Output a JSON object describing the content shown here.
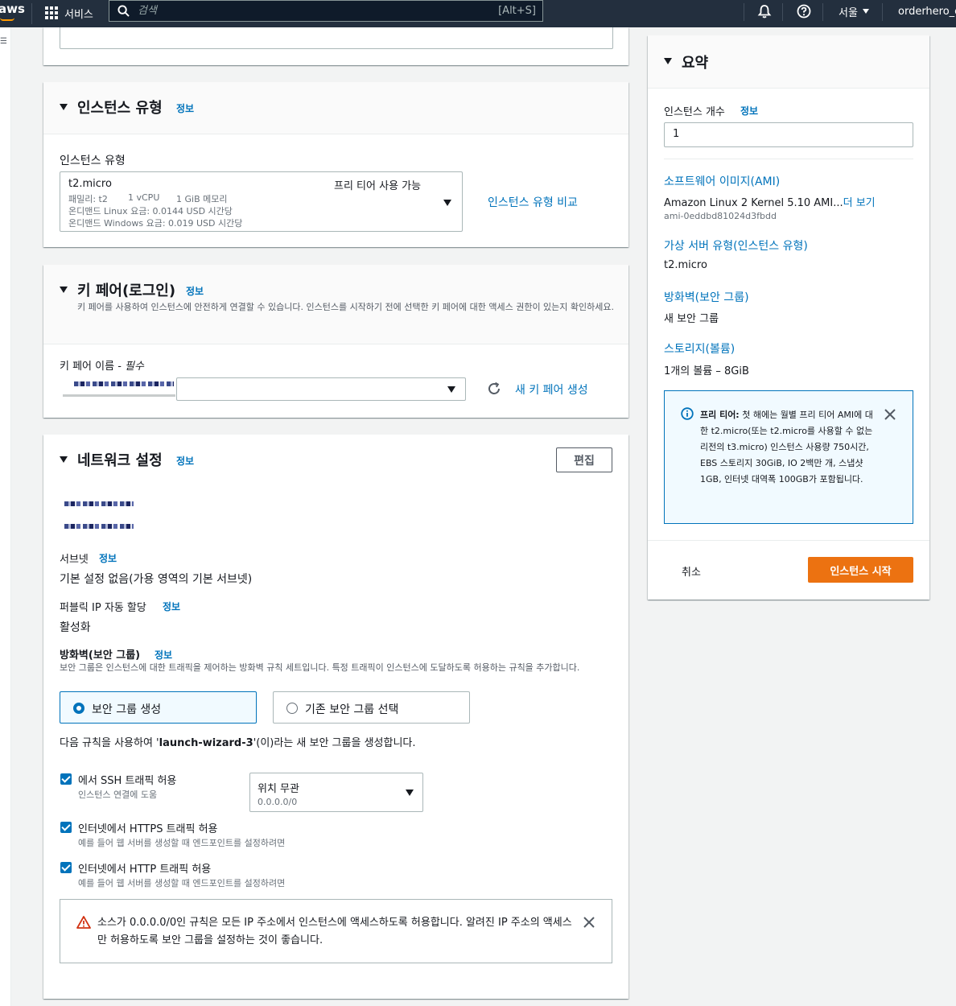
{
  "nav": {
    "logo": "aws",
    "services_label": "서비스",
    "search_placeholder": "검색",
    "search_shortcut": "[Alt+S]",
    "region": "서울",
    "account": "orderhero_ch"
  },
  "left_rail": {
    "glyph": "☰"
  },
  "instance_type": {
    "title": "인스턴스 유형",
    "info": "정보",
    "field_label": "인스턴스 유형",
    "selected": {
      "name": "t2.micro",
      "free_tier": "프리 티어 사용 가능",
      "family": "패밀리: t2",
      "vcpu": "1 vCPU",
      "memory": "1 GiB 메모리",
      "linux_price": "온디맨드 Linux 요금: 0.0144 USD 시간당",
      "windows_price": "온디맨드 Windows 요금: 0.019 USD 시간당"
    },
    "compare_link": "인스턴스 유형 비교"
  },
  "key_pair": {
    "title": "키 페어(로그인)",
    "info": "정보",
    "description": "키 페어를 사용하여 인스턴스에 안전하게 연결할 수 있습니다. 인스턴스를 시작하기 전에 선택한 키 페어에 대한 액세스 권한이 있는지 확인하세요.",
    "field_label": "키 페어 이름 - ",
    "required": "필수",
    "create_link": "새 키 페어 생성"
  },
  "network": {
    "title": "네트워크 설정",
    "info": "정보",
    "edit_button": "편집",
    "subnet_label": "서브넷",
    "subnet_info": "정보",
    "subnet_value": "기본 설정 없음(가용 영역의 기본 서브넷)",
    "public_ip_label": "퍼블릭 IP 자동 할당",
    "public_ip_info": "정보",
    "public_ip_value": "활성화",
    "firewall_label": "방화벽(보안 그룹)",
    "firewall_info": "정보",
    "firewall_desc": "보안 그룹은 인스턴스에 대한 트래픽을 제어하는 방화벽 규칙 세트입니다. 특정 트래픽이 인스턴스에 도달하도록 허용하는 규칙을 추가합니다.",
    "radio_create": "보안 그룹 생성",
    "radio_existing": "기존 보안 그룹 선택",
    "rule_text_prefix": "다음 규칙을 사용하여 '",
    "rule_text_name": "launch-wizard-3",
    "rule_text_suffix": "'(이)라는 새 보안 그룹을 생성합니다.",
    "rules": [
      {
        "label": "에서 SSH 트래픽 허용",
        "desc": "인스턴스 연결에 도움"
      },
      {
        "label": "인터넷에서 HTTPS 트래픽 허용",
        "desc": "예를 들어 웹 서버를 생성할 때 엔드포인트를 설정하려면"
      },
      {
        "label": "인터넷에서 HTTP 트래픽 허용",
        "desc": "예를 들어 웹 서버를 생성할 때 엔드포인트를 설정하려면"
      }
    ],
    "ssh_source": {
      "value": "위치 무관",
      "sub": "0.0.0.0/0"
    },
    "warning": "소스가 0.0.0.0/0인 규칙은 모든 IP 주소에서 인스턴스에 액세스하도록 허용합니다. 알려진 IP 주소의 액세스만 허용하도록 보안 그룹을 설정하는 것이 좋습니다."
  },
  "summary": {
    "title": "요약",
    "count_label": "인스턴스 개수",
    "count_info": "정보",
    "count_value": "1",
    "ami_label": "소프트웨어 이미지(AMI)",
    "ami_value": "Amazon Linux 2 Kernel 5.10 AMI...",
    "ami_more": "더 보기",
    "ami_id": "ami-0eddbd81024d3fbdd",
    "vtype_label": "가상 서버 유형(인스턴스 유형)",
    "vtype_value": "t2.micro",
    "firewall_label": "방화벽(보안 그룹)",
    "firewall_value": "새 보안 그룹",
    "storage_label": "스토리지(볼륨)",
    "storage_value": "1개의 볼륨 – 8GiB",
    "free_tier_title": "프리 티어:",
    "free_tier_text": " 첫 해에는 월별 프리 티어 AMI에 대한 t2.micro(또는 t2.micro를 사용할 수 없는 리전의 t3.micro) 인스턴스 사용량 750시간, EBS 스토리지 30GiB, IO 2백만 개, 스냅샷 1GB, 인터넷 대역폭 100GB가 포함됩니다.",
    "cancel": "취소",
    "launch": "인스턴스 시작"
  },
  "colors": {
    "nav_bg": "#232f3e",
    "link": "#0073bb",
    "primary": "#ec7211",
    "warning": "#d13212"
  }
}
